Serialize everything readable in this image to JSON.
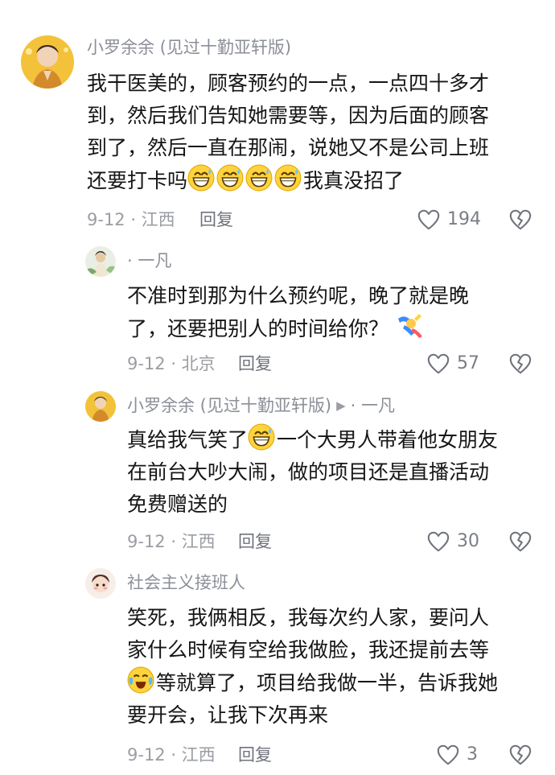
{
  "comments": [
    {
      "username": "小罗余余 (见过十勤亚轩版)",
      "lines": [
        "我干医美的，顾客预约的一点，一点四十多才",
        "到，然后我们告知她需要等，因为后面的顾客",
        "到了，然后一直在那闹，说她又不是公司上班"
      ],
      "last_line_prefix": "还要打卡吗",
      "last_line_suffix": "我真没招了",
      "meta": "9-12 · 江西",
      "reply_label": "回复",
      "likes": "194"
    },
    {
      "username": "· 一凡",
      "lines": [
        "不准时到那为什么预约呢，晚了就是晚"
      ],
      "last_line_prefix": "了，还要把别人的时间给你？",
      "meta": "9-12 · 北京",
      "reply_label": "回复",
      "likes": "57"
    },
    {
      "username": "小罗余余 (见过十勤亚轩版)",
      "reply_to": "· 一凡",
      "first_line_prefix": "真给我气笑了",
      "first_line_suffix": "一个大男人带着他女朋友",
      "lines": [
        "在前台大吵大闹，做的项目还是直播活动",
        "免费赠送的"
      ],
      "meta": "9-12 · 江西",
      "reply_label": "回复",
      "likes": "30"
    },
    {
      "username": "社会主义接班人",
      "lines": [
        "笑死，我俩相反，我每次约人家，要问人",
        "家什么时候有空给我做脸，我还提前去等"
      ],
      "third_line_suffix": "等就算了，项目给我做一半，告诉我她",
      "last_line": "要开会，让我下次再来",
      "meta": "9-12 · 江西",
      "reply_label": "回复",
      "likes": "3"
    }
  ],
  "icons": {
    "like": "heart-outline-icon",
    "dislike": "broken-heart-icon",
    "grin": "grinning-sweat-emoji",
    "cry": "crying-laugh-emoji",
    "dab": "dab-emoji"
  },
  "colors": {
    "text": "#161616",
    "muted": "#9a9da3",
    "username": "#8b8f97",
    "emoji_yellow": "#ffd33d"
  }
}
